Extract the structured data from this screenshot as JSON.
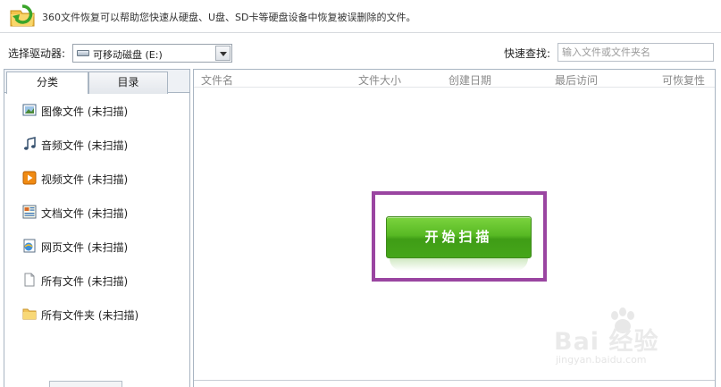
{
  "header": {
    "description": "360文件恢复可以帮助您快速从硬盘、U盘、SD卡等硬盘设备中恢复被误删除的文件。"
  },
  "toolbar": {
    "drive_label": "选择驱动器:",
    "drive_value": "可移动磁盘 (E:)",
    "search_label": "快速查找:",
    "search_placeholder": "输入文件或文件夹名"
  },
  "tabs": [
    {
      "label": "分类",
      "active": true
    },
    {
      "label": "目录",
      "active": false
    }
  ],
  "categories": [
    {
      "label": "图像文件 (未扫描)",
      "icon": "image-icon"
    },
    {
      "label": "音频文件 (未扫描)",
      "icon": "music-note-icon"
    },
    {
      "label": "视频文件 (未扫描)",
      "icon": "video-icon"
    },
    {
      "label": "文档文件 (未扫描)",
      "icon": "document-icon"
    },
    {
      "label": "网页文件 (未扫描)",
      "icon": "web-page-icon"
    },
    {
      "label": "所有文件 (未扫描)",
      "icon": "file-icon"
    },
    {
      "label": "所有文件夹 (未扫描)",
      "icon": "folder-icon"
    }
  ],
  "columns": [
    "文件名",
    "文件大小",
    "创建日期",
    "最后访问",
    "可恢复性"
  ],
  "scan_button": {
    "label": "开始扫描"
  },
  "watermark": {
    "text": "Bai 经验",
    "url": "jingyan.baidu.com"
  },
  "colors": {
    "scan_green": "#58b924",
    "highlight_purple": "#9a45a1",
    "panel_border": "#a9b5c2"
  }
}
